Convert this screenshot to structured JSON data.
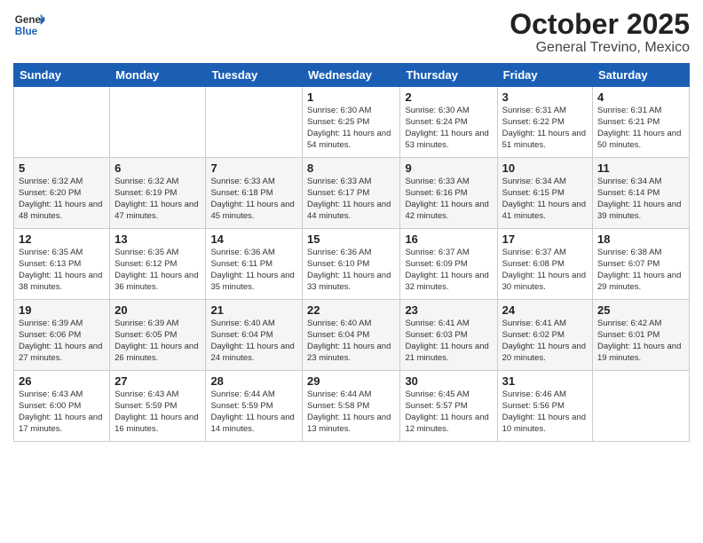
{
  "logo": {
    "text_general": "General",
    "text_blue": "Blue"
  },
  "title": "October 2025",
  "subtitle": "General Trevino, Mexico",
  "days_of_week": [
    "Sunday",
    "Monday",
    "Tuesday",
    "Wednesday",
    "Thursday",
    "Friday",
    "Saturday"
  ],
  "weeks": [
    [
      {
        "day": "",
        "info": ""
      },
      {
        "day": "",
        "info": ""
      },
      {
        "day": "",
        "info": ""
      },
      {
        "day": "1",
        "info": "Sunrise: 6:30 AM\nSunset: 6:25 PM\nDaylight: 11 hours\nand 54 minutes."
      },
      {
        "day": "2",
        "info": "Sunrise: 6:30 AM\nSunset: 6:24 PM\nDaylight: 11 hours\nand 53 minutes."
      },
      {
        "day": "3",
        "info": "Sunrise: 6:31 AM\nSunset: 6:22 PM\nDaylight: 11 hours\nand 51 minutes."
      },
      {
        "day": "4",
        "info": "Sunrise: 6:31 AM\nSunset: 6:21 PM\nDaylight: 11 hours\nand 50 minutes."
      }
    ],
    [
      {
        "day": "5",
        "info": "Sunrise: 6:32 AM\nSunset: 6:20 PM\nDaylight: 11 hours\nand 48 minutes."
      },
      {
        "day": "6",
        "info": "Sunrise: 6:32 AM\nSunset: 6:19 PM\nDaylight: 11 hours\nand 47 minutes."
      },
      {
        "day": "7",
        "info": "Sunrise: 6:33 AM\nSunset: 6:18 PM\nDaylight: 11 hours\nand 45 minutes."
      },
      {
        "day": "8",
        "info": "Sunrise: 6:33 AM\nSunset: 6:17 PM\nDaylight: 11 hours\nand 44 minutes."
      },
      {
        "day": "9",
        "info": "Sunrise: 6:33 AM\nSunset: 6:16 PM\nDaylight: 11 hours\nand 42 minutes."
      },
      {
        "day": "10",
        "info": "Sunrise: 6:34 AM\nSunset: 6:15 PM\nDaylight: 11 hours\nand 41 minutes."
      },
      {
        "day": "11",
        "info": "Sunrise: 6:34 AM\nSunset: 6:14 PM\nDaylight: 11 hours\nand 39 minutes."
      }
    ],
    [
      {
        "day": "12",
        "info": "Sunrise: 6:35 AM\nSunset: 6:13 PM\nDaylight: 11 hours\nand 38 minutes."
      },
      {
        "day": "13",
        "info": "Sunrise: 6:35 AM\nSunset: 6:12 PM\nDaylight: 11 hours\nand 36 minutes."
      },
      {
        "day": "14",
        "info": "Sunrise: 6:36 AM\nSunset: 6:11 PM\nDaylight: 11 hours\nand 35 minutes."
      },
      {
        "day": "15",
        "info": "Sunrise: 6:36 AM\nSunset: 6:10 PM\nDaylight: 11 hours\nand 33 minutes."
      },
      {
        "day": "16",
        "info": "Sunrise: 6:37 AM\nSunset: 6:09 PM\nDaylight: 11 hours\nand 32 minutes."
      },
      {
        "day": "17",
        "info": "Sunrise: 6:37 AM\nSunset: 6:08 PM\nDaylight: 11 hours\nand 30 minutes."
      },
      {
        "day": "18",
        "info": "Sunrise: 6:38 AM\nSunset: 6:07 PM\nDaylight: 11 hours\nand 29 minutes."
      }
    ],
    [
      {
        "day": "19",
        "info": "Sunrise: 6:39 AM\nSunset: 6:06 PM\nDaylight: 11 hours\nand 27 minutes."
      },
      {
        "day": "20",
        "info": "Sunrise: 6:39 AM\nSunset: 6:05 PM\nDaylight: 11 hours\nand 26 minutes."
      },
      {
        "day": "21",
        "info": "Sunrise: 6:40 AM\nSunset: 6:04 PM\nDaylight: 11 hours\nand 24 minutes."
      },
      {
        "day": "22",
        "info": "Sunrise: 6:40 AM\nSunset: 6:04 PM\nDaylight: 11 hours\nand 23 minutes."
      },
      {
        "day": "23",
        "info": "Sunrise: 6:41 AM\nSunset: 6:03 PM\nDaylight: 11 hours\nand 21 minutes."
      },
      {
        "day": "24",
        "info": "Sunrise: 6:41 AM\nSunset: 6:02 PM\nDaylight: 11 hours\nand 20 minutes."
      },
      {
        "day": "25",
        "info": "Sunrise: 6:42 AM\nSunset: 6:01 PM\nDaylight: 11 hours\nand 19 minutes."
      }
    ],
    [
      {
        "day": "26",
        "info": "Sunrise: 6:43 AM\nSunset: 6:00 PM\nDaylight: 11 hours\nand 17 minutes."
      },
      {
        "day": "27",
        "info": "Sunrise: 6:43 AM\nSunset: 5:59 PM\nDaylight: 11 hours\nand 16 minutes."
      },
      {
        "day": "28",
        "info": "Sunrise: 6:44 AM\nSunset: 5:59 PM\nDaylight: 11 hours\nand 14 minutes."
      },
      {
        "day": "29",
        "info": "Sunrise: 6:44 AM\nSunset: 5:58 PM\nDaylight: 11 hours\nand 13 minutes."
      },
      {
        "day": "30",
        "info": "Sunrise: 6:45 AM\nSunset: 5:57 PM\nDaylight: 11 hours\nand 12 minutes."
      },
      {
        "day": "31",
        "info": "Sunrise: 6:46 AM\nSunset: 5:56 PM\nDaylight: 11 hours\nand 10 minutes."
      },
      {
        "day": "",
        "info": ""
      }
    ]
  ]
}
